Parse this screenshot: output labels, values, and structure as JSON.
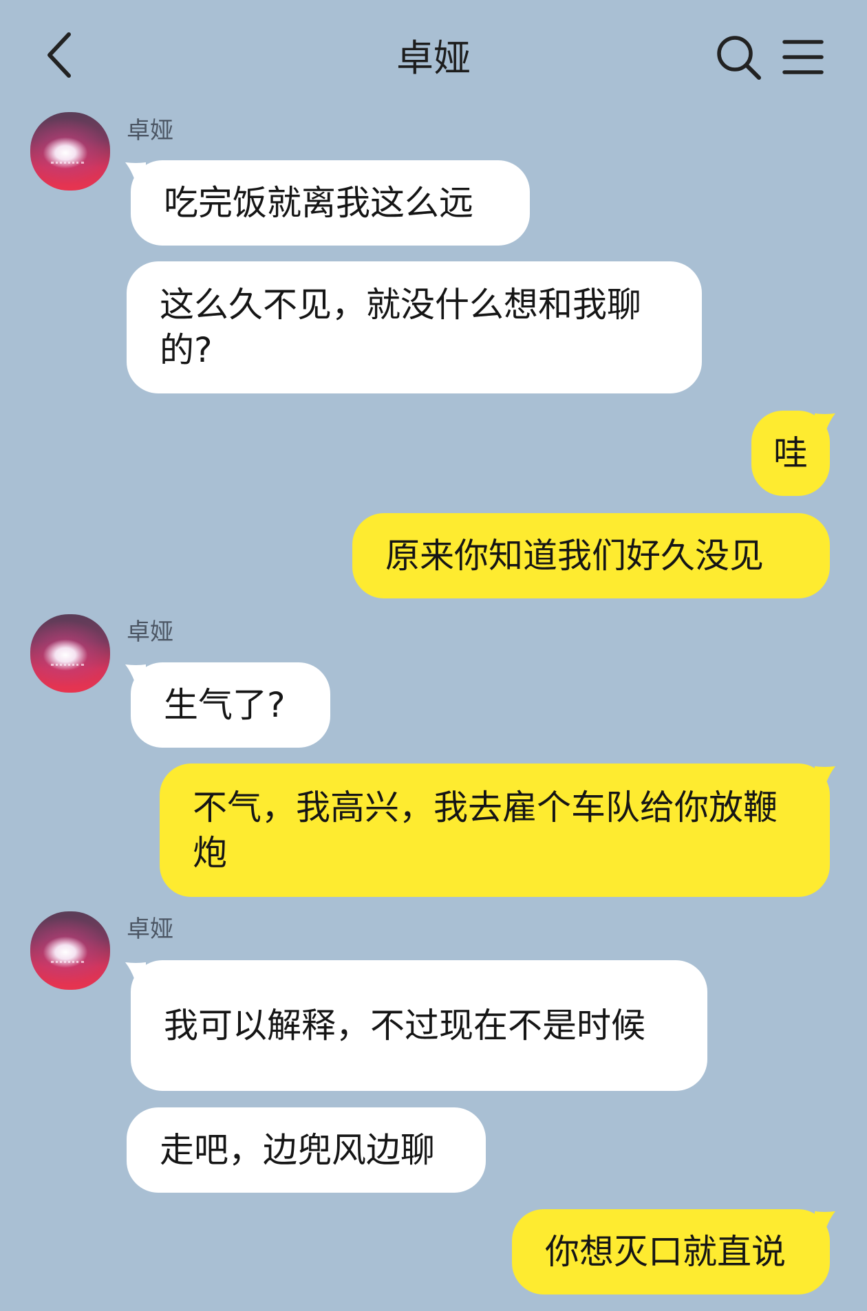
{
  "header": {
    "title": "卓娅"
  },
  "contact": {
    "name": "卓娅"
  },
  "icons": {
    "back": "back-arrow-icon",
    "search": "search-icon",
    "menu": "hamburger-menu-icon"
  },
  "colors": {
    "background": "#a9bfd3",
    "incoming_bubble": "#ffffff",
    "outgoing_bubble": "#feeb30"
  },
  "messages": [
    {
      "from": "contact",
      "sender": "卓娅",
      "text": "吃完饭就离我这么远"
    },
    {
      "from": "contact",
      "text": "这么久不见，就没什么想和我聊的?"
    },
    {
      "from": "me",
      "text": "哇"
    },
    {
      "from": "me",
      "text": "原来你知道我们好久没见"
    },
    {
      "from": "contact",
      "sender": "卓娅",
      "text": "生气了?"
    },
    {
      "from": "me",
      "text": "不气，我高兴，我去雇个车队给你放鞭炮"
    },
    {
      "from": "contact",
      "sender": "卓娅",
      "text": "我可以解释，不过现在不是时候"
    },
    {
      "from": "contact",
      "text": "走吧，边兜风边聊"
    },
    {
      "from": "me",
      "text": "你想灭口就直说"
    }
  ]
}
